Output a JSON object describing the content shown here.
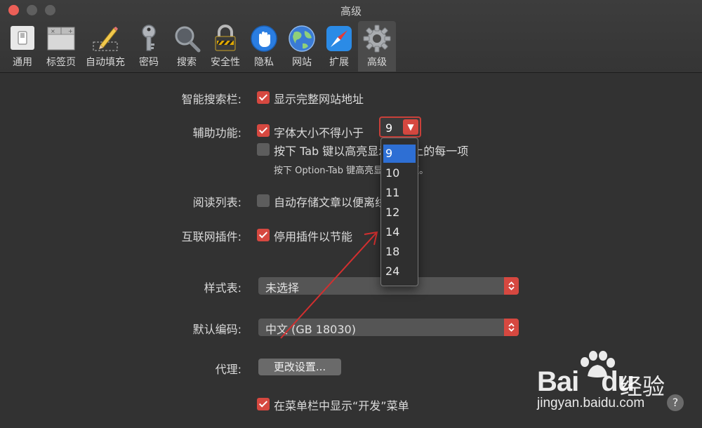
{
  "window": {
    "title": "高级"
  },
  "tabs": [
    {
      "label": "通用",
      "icon": "switch-icon"
    },
    {
      "label": "标签页",
      "icon": "tabs-icon"
    },
    {
      "label": "自动填充",
      "icon": "pencil-icon"
    },
    {
      "label": "密码",
      "icon": "key-icon"
    },
    {
      "label": "搜索",
      "icon": "magnifier-icon"
    },
    {
      "label": "安全性",
      "icon": "lock-icon"
    },
    {
      "label": "隐私",
      "icon": "hand-icon"
    },
    {
      "label": "网站",
      "icon": "globe-icon"
    },
    {
      "label": "扩展",
      "icon": "compass-icon"
    },
    {
      "label": "高级",
      "icon": "gear-icon"
    }
  ],
  "settings": {
    "smart_search_label": "智能搜索栏:",
    "show_full_address": "显示完整网站地址",
    "accessibility_label": "辅助功能:",
    "min_font_size": "字体大小不得小于",
    "min_font_value": "9",
    "tab_highlight": "按下 Tab 键以高亮显示网页上的每一项",
    "tab_highlight_note": "按下 Option-Tab 键高亮显示每一项。",
    "reading_list_label": "阅读列表:",
    "save_articles": "自动存储文章以便离线阅读",
    "plugins_label": "互联网插件:",
    "stop_plugins": "停用插件以节能",
    "stylesheet_label": "样式表:",
    "stylesheet_value": "未选择",
    "encoding_label": "默认编码:",
    "encoding_value": "中文 (GB 18030)",
    "proxy_label": "代理:",
    "proxy_button": "更改设置...",
    "develop_menu": "在菜单栏中显示“开发”菜单"
  },
  "font_size_options": [
    "9",
    "10",
    "11",
    "12",
    "14",
    "18",
    "24"
  ],
  "watermark": {
    "logo": "Bai",
    "logo_tail": "du",
    "brand_cn": "经验",
    "url": "jingyan.baidu.com",
    "help": "?"
  },
  "colors": {
    "accent": "#d64840",
    "selection": "#2e6fd4",
    "background": "#323232"
  }
}
